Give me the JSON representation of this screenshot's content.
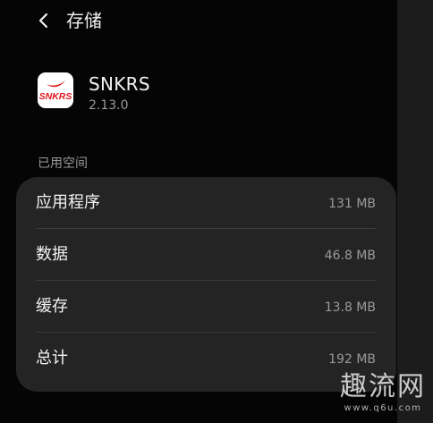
{
  "header": {
    "title": "存储"
  },
  "app": {
    "icon_text": "SNKRS",
    "name": "SNKRS",
    "version": "2.13.0"
  },
  "section": {
    "label": "已用空间"
  },
  "storage": {
    "rows": [
      {
        "label": "应用程序",
        "value": "131 MB"
      },
      {
        "label": "数据",
        "value": "46.8 MB"
      },
      {
        "label": "缓存",
        "value": "13.8 MB"
      },
      {
        "label": "总计",
        "value": "192 MB"
      }
    ]
  },
  "watermark": {
    "logo": "趣流网",
    "url": "www.q6u.com"
  },
  "colors": {
    "background": "#050505",
    "card": "#242424",
    "text": "#f2f2f2",
    "secondary": "#9a9a9a",
    "icon_red": "#e0181e"
  },
  "icons": {
    "back": "chevron-left-icon",
    "app": "snkrs-app-icon"
  }
}
